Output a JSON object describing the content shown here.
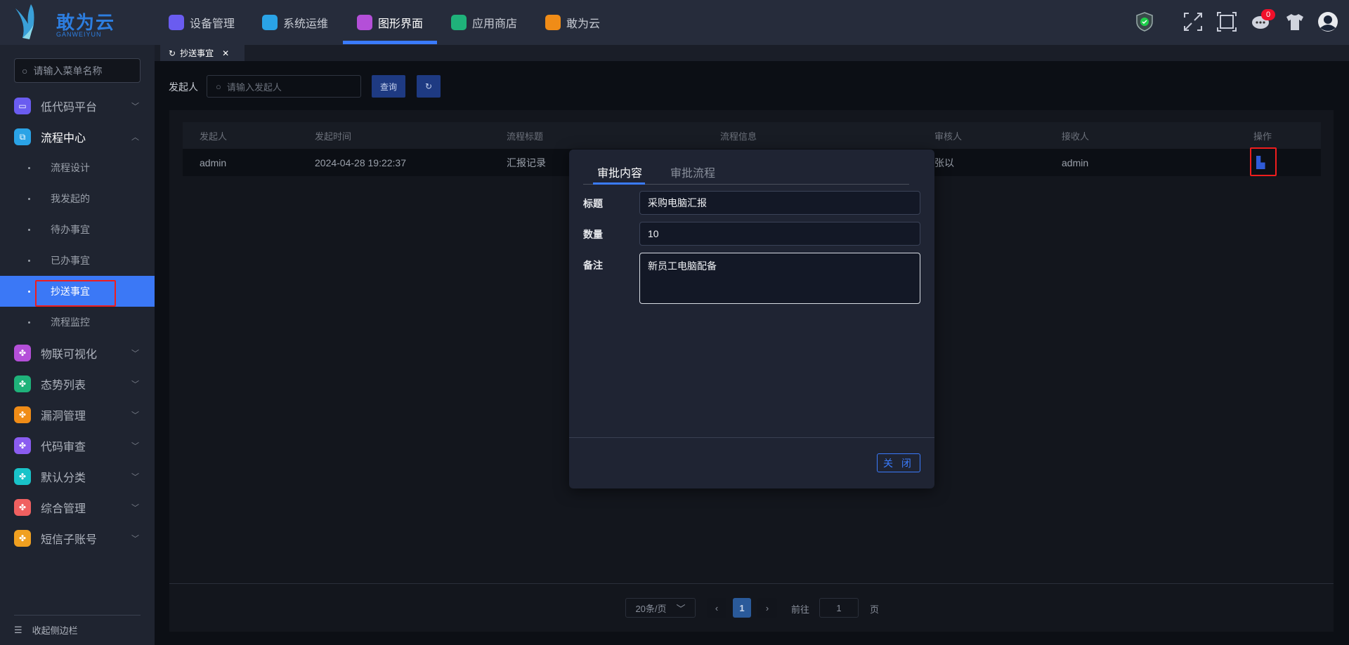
{
  "header": {
    "logo_text": "敢为云",
    "logo_sub": "GANWEIYUN",
    "nav": [
      {
        "label": "设备管理",
        "color": "#6a5cf0"
      },
      {
        "label": "系统运维",
        "color": "#2aa3e6"
      },
      {
        "label": "图形界面",
        "color": "#b44fd8"
      },
      {
        "label": "应用商店",
        "color": "#1fb27a"
      },
      {
        "label": "敢为云",
        "color": "#f08c17"
      }
    ],
    "active_nav": "图形界面",
    "icons": [
      "shield-icon",
      "fullscreen-icon",
      "frame-icon",
      "chat-icon",
      "shirt-icon",
      "avatar-icon"
    ],
    "chat_badge": "0"
  },
  "sidebar": {
    "search_placeholder": "请输入菜单名称",
    "menu": [
      {
        "label": "低代码平台",
        "color": "#6a5cf0",
        "chev": "﹀"
      },
      {
        "label": "流程中心",
        "color": "#2aa3e6",
        "chev": "︿"
      }
    ],
    "sub": [
      "流程设计",
      "我发起的",
      "待办事宜",
      "已办事宜",
      "抄送事宜",
      "流程监控"
    ],
    "active_sub": "抄送事宜",
    "menu2": [
      {
        "label": "物联可视化",
        "color": "#b44fd8"
      },
      {
        "label": "态势列表",
        "color": "#1fb27a"
      },
      {
        "label": "漏洞管理",
        "color": "#f08c17"
      },
      {
        "label": "代码审查",
        "color": "#8a5cf0"
      },
      {
        "label": "默认分类",
        "color": "#19c3c9"
      },
      {
        "label": "综合管理",
        "color": "#f06060"
      },
      {
        "label": "短信子账号",
        "color": "#f0a020"
      }
    ],
    "collapse": "收起侧边栏"
  },
  "tabbar": {
    "tab": "抄送事宜"
  },
  "filter": {
    "label": "发起人",
    "placeholder": "请输入发起人",
    "query": "查询"
  },
  "table": {
    "headers": [
      "发起人",
      "发起时间",
      "流程标题",
      "流程信息",
      "审核人",
      "接收人",
      "操作"
    ],
    "rows": [
      [
        "admin",
        "2024-04-28 19:22:37",
        "汇报记录",
        "",
        "张以",
        "admin",
        ""
      ]
    ]
  },
  "pagination": {
    "page_size": "20条/页",
    "current": "1",
    "goto": "前往",
    "goto_value": "1",
    "page_suffix": "页"
  },
  "dialog": {
    "tabs": [
      "审批内容",
      "审批流程"
    ],
    "fields": [
      {
        "label": "标题",
        "value": "采购电脑汇报"
      },
      {
        "label": "数量",
        "value": "10"
      },
      {
        "label": "备注",
        "value": "新员工电脑配备"
      }
    ],
    "close": "关 闭"
  }
}
